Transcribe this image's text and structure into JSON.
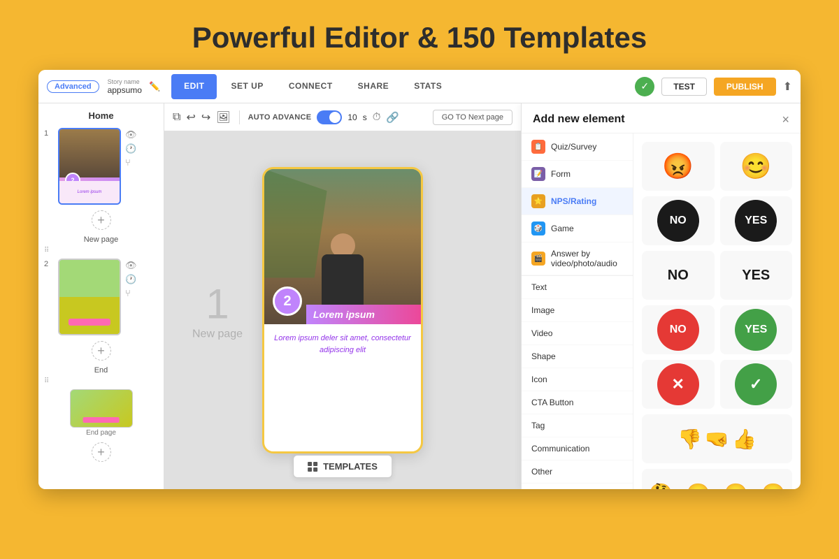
{
  "header": {
    "title": "Powerful Editor & 150 Templates"
  },
  "topbar": {
    "advanced_label": "Advanced",
    "story_name_label": "Story name",
    "story_name_value": "appsumo",
    "edit_btn": "EDIT",
    "setup_btn": "SET UP",
    "connect_btn": "CONNECT",
    "share_btn": "SHARE",
    "stats_btn": "STATS",
    "test_btn": "TEST",
    "publish_btn": "PUBLISH"
  },
  "sidebar": {
    "home_label": "Home",
    "page1_number": "1",
    "new_page_label": "New page",
    "page2_number": "2",
    "end_label": "End",
    "end_page_label": "End page"
  },
  "toolbar": {
    "auto_advance_label": "AUTO ADVANCE",
    "timer_value": "10",
    "timer_unit": "s",
    "goto_label": "GO TO  Next page"
  },
  "canvas": {
    "new_page_number": "1",
    "new_page_label": "New page",
    "story_badge": "2",
    "story_title": "Lorem ipsum",
    "lorem_body": "Lorem ipsum deler sit amet, consectetur adipiscing elit",
    "templates_btn": "TEMPLATES"
  },
  "panel": {
    "title": "Add new element",
    "close": "×",
    "items": [
      {
        "label": "Quiz/Survey",
        "icon_class": "li-quiz",
        "icon": "📋"
      },
      {
        "label": "Form",
        "icon_class": "li-form",
        "icon": "📝"
      },
      {
        "label": "NPS/Rating",
        "icon_class": "li-nps",
        "icon": "⭐",
        "selected": true
      },
      {
        "label": "Game",
        "icon_class": "li-game",
        "icon": "🎲"
      },
      {
        "label": "Answer by video/photo/audio",
        "icon_class": "li-answer",
        "icon": "🎬"
      },
      {
        "label": "Text",
        "icon_class": "li-no-icon",
        "icon": ""
      },
      {
        "label": "Image",
        "icon_class": "li-no-icon",
        "icon": ""
      },
      {
        "label": "Video",
        "icon_class": "li-no-icon",
        "icon": ""
      },
      {
        "label": "Shape",
        "icon_class": "li-no-icon",
        "icon": ""
      },
      {
        "label": "Icon",
        "icon_class": "li-no-icon",
        "icon": ""
      },
      {
        "label": "CTA Button",
        "icon_class": "li-no-icon",
        "icon": ""
      },
      {
        "label": "Tag",
        "icon_class": "li-no-icon",
        "icon": ""
      },
      {
        "label": "Communication",
        "icon_class": "li-no-icon",
        "icon": ""
      },
      {
        "label": "Other",
        "icon_class": "li-no-icon",
        "icon": ""
      }
    ]
  }
}
